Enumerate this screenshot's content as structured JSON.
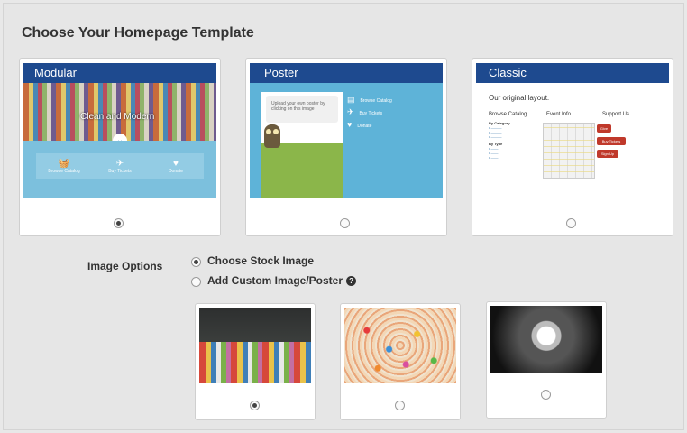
{
  "page": {
    "title": "Choose Your Homepage Template"
  },
  "templates": [
    {
      "name": "Modular",
      "selected": true,
      "preview": {
        "hero_text": "Clean and Modern",
        "items": [
          "Browse Catalog",
          "Buy Tickets",
          "Donate"
        ]
      }
    },
    {
      "name": "Poster",
      "selected": false,
      "preview": {
        "bubble": "Upload your own poster by clicking on this image",
        "links": [
          "Browse Catalog",
          "Buy Tickets",
          "Donate"
        ]
      }
    },
    {
      "name": "Classic",
      "selected": false,
      "preview": {
        "subtitle": "Our original layout.",
        "col1": "Browse Catalog",
        "col2": "Event Info",
        "col3": "Support Us",
        "by_category": "By Category",
        "by_type": "By Type",
        "buttons": [
          "Give",
          "Buy Tickets",
          "Sign Up"
        ]
      }
    }
  ],
  "image_options": {
    "label": "Image Options",
    "choices": [
      {
        "label": "Choose Stock Image",
        "selected": true
      },
      {
        "label": "Add Custom Image/Poster",
        "selected": false,
        "help": "?"
      }
    ]
  },
  "stock_images": [
    {
      "subject": "colored-pencils",
      "selected": true
    },
    {
      "subject": "sprinkles",
      "selected": false
    },
    {
      "subject": "disco-ball",
      "selected": false
    }
  ],
  "colors": {
    "header_blue": "#1e4a8f",
    "modular_band": "#7cc0dd",
    "poster_blue": "#5eb3d8",
    "poster_green": "#8bb64a",
    "classic_button": "#c0392b"
  }
}
